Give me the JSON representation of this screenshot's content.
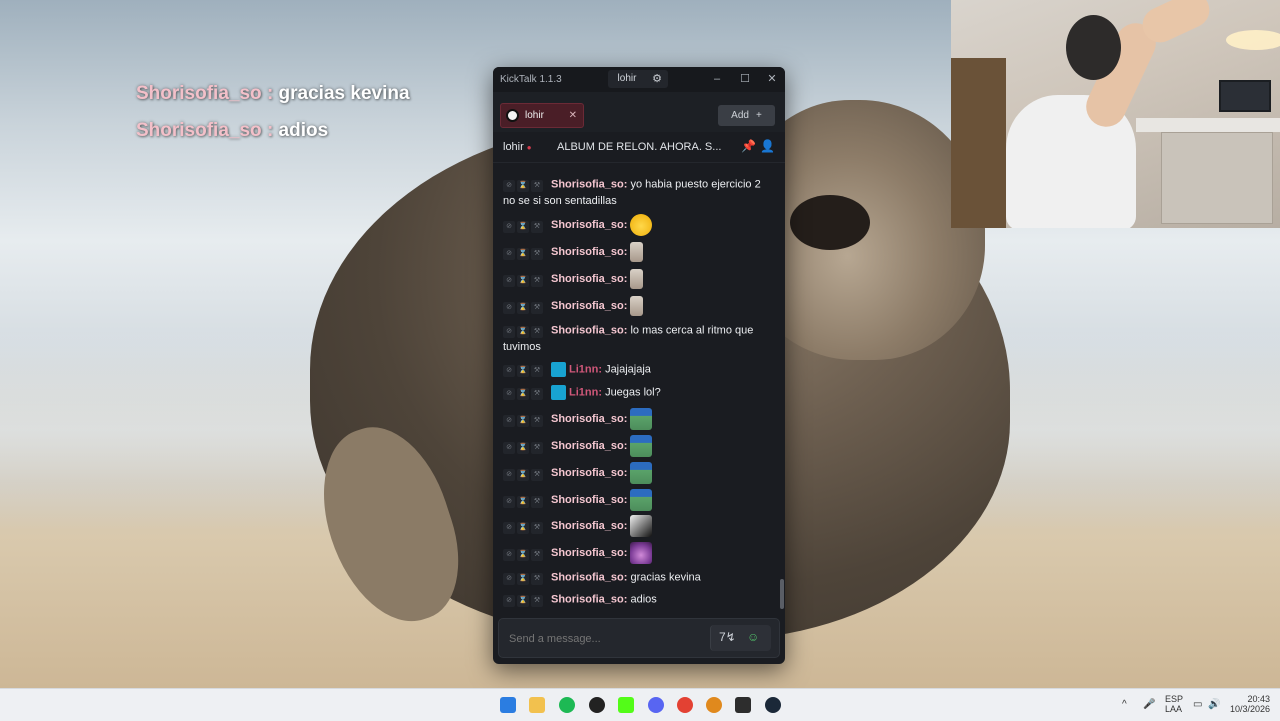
{
  "overlay": {
    "lines": [
      {
        "user": "Shorisofia_so",
        "sep": ":",
        "text": "gracias kevina"
      },
      {
        "user": "Shorisofia_so",
        "sep": ":",
        "text": "adios"
      }
    ]
  },
  "window": {
    "title": "KickTalk 1.1.3",
    "current_user": "lohir",
    "gear_icon": "⚙",
    "min_icon": "–",
    "max_icon": "☐",
    "close_icon": "✕"
  },
  "tabs": {
    "channel": "lohir",
    "close_icon": "✕",
    "add_label": "Add",
    "add_icon": "+"
  },
  "info": {
    "channel": "lohir",
    "live_dot": "●",
    "stream_title": "ALBUM DE RELON. AHORA. S...",
    "pin_icon": "📌",
    "user_icon": "👤"
  },
  "messages": [
    {
      "user": "Shorisofia_so:",
      "text": "yo habia puesto ejercicio 2",
      "text2": "no se si son sentadillas"
    },
    {
      "user": "Shorisofia_so:",
      "emote": "yellow"
    },
    {
      "user": "Shorisofia_so:",
      "emote": "gray"
    },
    {
      "user": "Shorisofia_so:",
      "emote": "gray"
    },
    {
      "user": "Shorisofia_so:",
      "emote": "gray"
    },
    {
      "user": "Shorisofia_so:",
      "text": "lo mas cerca al ritmo que",
      "text2": "tuvimos"
    },
    {
      "user": "Li1nn:",
      "text": "Jajajajaja"
    },
    {
      "user": "Li1nn:",
      "text": "Juegas lol?"
    },
    {
      "user": "Shorisofia_so:",
      "emote": "pepe"
    },
    {
      "user": "Shorisofia_so:",
      "emote": "pepe"
    },
    {
      "user": "Shorisofia_so:",
      "emote": "pepe"
    },
    {
      "user": "Shorisofia_so:",
      "emote": "pepe"
    },
    {
      "user": "Shorisofia_so:",
      "emote": "bw"
    },
    {
      "user": "Shorisofia_so:",
      "emote": "purple"
    },
    {
      "user": "Shorisofia_so:",
      "text": "gracias kevina"
    },
    {
      "user": "Shorisofia_so:",
      "text": "adios"
    }
  ],
  "mod_icons": [
    "⊘",
    "⌛",
    "⚒"
  ],
  "composer": {
    "placeholder": "Send a message...",
    "translate_icon": "7↯",
    "emote_icon": "☺"
  },
  "taskbar": {
    "lang": "ESP",
    "lang2": "LAA",
    "time": "20:43",
    "date": "10/3/2026"
  }
}
